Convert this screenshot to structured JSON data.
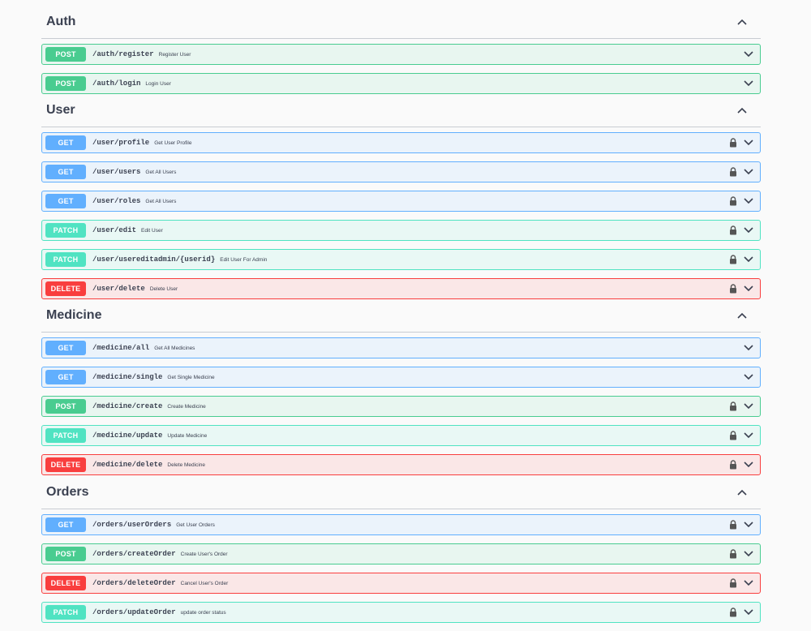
{
  "sections": [
    {
      "title": "Auth",
      "ops": [
        {
          "method": "POST",
          "cls": "post",
          "path": "/auth/register",
          "summary": "Register User",
          "locked": false
        },
        {
          "method": "POST",
          "cls": "post",
          "path": "/auth/login",
          "summary": "Login User",
          "locked": false
        }
      ]
    },
    {
      "title": "User",
      "ops": [
        {
          "method": "GET",
          "cls": "get",
          "path": "/user/profile",
          "summary": "Get User Profile",
          "locked": true
        },
        {
          "method": "GET",
          "cls": "get",
          "path": "/user/users",
          "summary": "Get All Users",
          "locked": true
        },
        {
          "method": "GET",
          "cls": "get",
          "path": "/user/roles",
          "summary": "Get All Users",
          "locked": true
        },
        {
          "method": "PATCH",
          "cls": "patch",
          "path": "/user/edit",
          "summary": "Edit User",
          "locked": true
        },
        {
          "method": "PATCH",
          "cls": "patch",
          "path": "/user/usereditadmin/{userid}",
          "summary": "Edit User For Admin",
          "locked": true
        },
        {
          "method": "DELETE",
          "cls": "delete",
          "path": "/user/delete",
          "summary": "Delete User",
          "locked": true
        }
      ]
    },
    {
      "title": "Medicine",
      "ops": [
        {
          "method": "GET",
          "cls": "get",
          "path": "/medicine/all",
          "summary": "Get All Medicines",
          "locked": false
        },
        {
          "method": "GET",
          "cls": "get",
          "path": "/medicine/single",
          "summary": "Get Single Medicine",
          "locked": false
        },
        {
          "method": "POST",
          "cls": "post",
          "path": "/medicine/create",
          "summary": "Create Medicine",
          "locked": true
        },
        {
          "method": "PATCH",
          "cls": "patch",
          "path": "/medicine/update",
          "summary": "Update Medicine",
          "locked": true
        },
        {
          "method": "DELETE",
          "cls": "delete",
          "path": "/medicine/delete",
          "summary": "Delete Medicine",
          "locked": true
        }
      ]
    },
    {
      "title": "Orders",
      "ops": [
        {
          "method": "GET",
          "cls": "get",
          "path": "/orders/userOrders",
          "summary": "Get User Orders",
          "locked": true
        },
        {
          "method": "POST",
          "cls": "post",
          "path": "/orders/createOrder",
          "summary": "Create User's Order",
          "locked": true
        },
        {
          "method": "DELETE",
          "cls": "delete",
          "path": "/orders/deleteOrder",
          "summary": "Cancel User's Order",
          "locked": true
        },
        {
          "method": "PATCH",
          "cls": "patch",
          "path": "/orders/updateOrder",
          "summary": "update order status",
          "locked": true
        }
      ]
    }
  ]
}
